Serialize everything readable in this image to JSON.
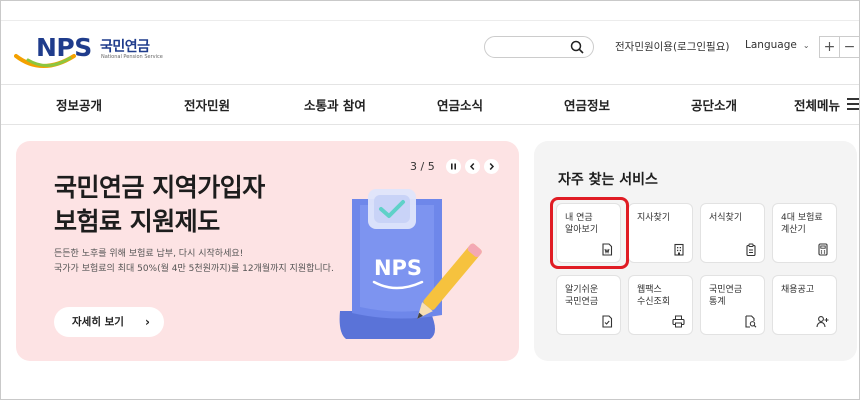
{
  "header": {
    "logo_text": "NPS",
    "logo_kr": "국민연금",
    "logo_en": "National Pension Service",
    "search_placeholder": "",
    "civil_link": "전자민원이용(로그인필요)",
    "language": "Language",
    "zoom_in": "+",
    "zoom_out": "−"
  },
  "nav": {
    "items": [
      "정보공개",
      "전자민원",
      "소통과 참여",
      "연금소식",
      "연금정보",
      "공단소개",
      "전체메뉴"
    ]
  },
  "banner": {
    "title_line1": "국민연금 지역가입자",
    "title_line2": "보험료 지원제도",
    "desc_line1": "든든한 노후를 위해 보험료 납부, 다시 시작하세요!",
    "desc_line2": "국가가 보험료의 최대 50%(월 4만 5천원까지)를 12개월까지 지원합니다.",
    "button_label": "자세히 보기",
    "pager": "3 / 5",
    "badge_text": "NPS",
    "bg_color": "#fde3e4"
  },
  "services": {
    "title": "자주 찾는 서비스",
    "items": [
      {
        "label": "내 연금\n알아보기",
        "icon": "document-w-icon"
      },
      {
        "label": "지사찾기",
        "icon": "building-icon"
      },
      {
        "label": "서식찾기",
        "icon": "clipboard-icon"
      },
      {
        "label": "4대 보험료\n계산기",
        "icon": "calculator-icon"
      },
      {
        "label": "알기쉬운\n국민연금",
        "icon": "document-check-icon"
      },
      {
        "label": "웹팩스\n수신조회",
        "icon": "printer-icon"
      },
      {
        "label": "국민연금\n통계",
        "icon": "document-search-icon"
      },
      {
        "label": "채용공고",
        "icon": "person-add-icon"
      }
    ],
    "highlight_color": "#e01c24"
  }
}
